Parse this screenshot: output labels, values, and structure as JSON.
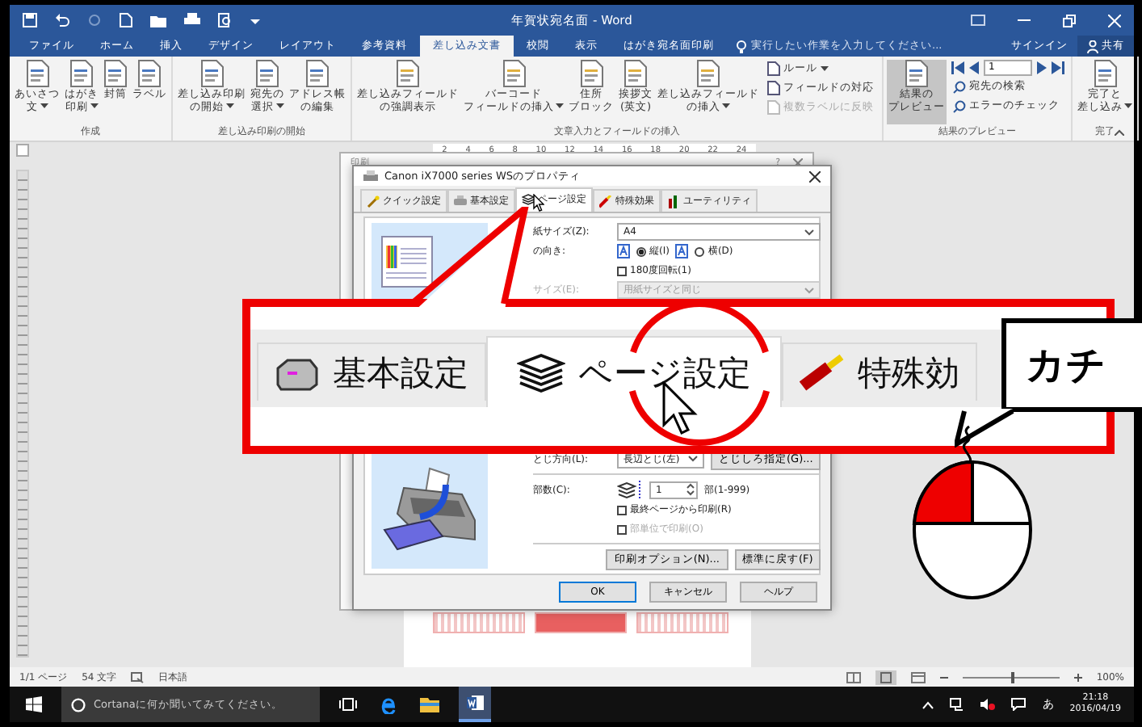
{
  "window": {
    "title": "年賀状宛名面 - Word"
  },
  "ribbon_tabs": [
    {
      "label": "ファイル",
      "selected": false
    },
    {
      "label": "ホーム",
      "selected": false
    },
    {
      "label": "挿入",
      "selected": false
    },
    {
      "label": "デザイン",
      "selected": false
    },
    {
      "label": "レイアウト",
      "selected": false
    },
    {
      "label": "参考資料",
      "selected": false
    },
    {
      "label": "差し込み文書",
      "selected": true
    },
    {
      "label": "校閲",
      "selected": false
    },
    {
      "label": "表示",
      "selected": false
    },
    {
      "label": "はがき宛名面印刷",
      "selected": false
    }
  ],
  "tell_me": {
    "placeholder": "実行したい作業を入力してください..."
  },
  "account": {
    "sign_in": "サインイン",
    "share": "共有"
  },
  "ribbon_groups": [
    {
      "label": "作成",
      "items": [
        {
          "kind": "large",
          "lines": [
            "あいさつ",
            "文"
          ],
          "dropdown": true,
          "selected": false
        },
        {
          "kind": "large",
          "lines": [
            "はがき",
            "印刷"
          ],
          "dropdown": true,
          "selected": false
        },
        {
          "kind": "large",
          "lines": [
            "封筒"
          ],
          "dropdown": false,
          "selected": false
        },
        {
          "kind": "large",
          "lines": [
            "ラベル"
          ],
          "dropdown": false,
          "selected": false
        }
      ]
    },
    {
      "label": "差し込み印刷の開始",
      "items": [
        {
          "kind": "large",
          "lines": [
            "差し込み印刷",
            "の開始"
          ],
          "dropdown": true,
          "selected": false
        },
        {
          "kind": "large",
          "lines": [
            "宛先の",
            "選択"
          ],
          "dropdown": true,
          "selected": false
        },
        {
          "kind": "large",
          "lines": [
            "アドレス帳",
            "の編集"
          ],
          "dropdown": false,
          "selected": false
        }
      ]
    },
    {
      "label": "文章入力とフィールドの挿入",
      "items": [
        {
          "kind": "large",
          "lines": [
            "差し込みフィールド",
            "の強調表示"
          ],
          "dropdown": false,
          "selected": false
        },
        {
          "kind": "large",
          "lines": [
            "バーコード",
            "フィールドの挿入"
          ],
          "dropdown": true,
          "selected": false
        },
        {
          "kind": "large",
          "lines": [
            "住所",
            "ブロック"
          ],
          "dropdown": false,
          "selected": false
        },
        {
          "kind": "large",
          "lines": [
            "挨拶文",
            "(英文)"
          ],
          "dropdown": false,
          "selected": false
        },
        {
          "kind": "large",
          "lines": [
            "差し込みフィールド",
            "の挿入"
          ],
          "dropdown": true,
          "selected": false
        },
        {
          "kind": "small",
          "items": [
            {
              "label": "ルール",
              "dropdown": true,
              "disabled": false
            },
            {
              "label": "フィールドの対応",
              "dropdown": false,
              "disabled": false
            },
            {
              "label": "複数ラベルに反映",
              "dropdown": false,
              "disabled": true
            }
          ]
        }
      ]
    },
    {
      "label": "結果のプレビュー",
      "items": [
        {
          "kind": "large",
          "lines": [
            "結果の",
            "プレビュー"
          ],
          "dropdown": false,
          "selected": true
        },
        {
          "kind": "nav",
          "value": "1",
          "items": [
            {
              "label": "宛先の検索",
              "dropdown": false,
              "disabled": false
            },
            {
              "label": "エラーのチェック",
              "dropdown": false,
              "disabled": false
            }
          ]
        }
      ]
    },
    {
      "label": "完了",
      "items": [
        {
          "kind": "large",
          "lines": [
            "完了と",
            "差し込み"
          ],
          "dropdown": true,
          "selected": false
        }
      ]
    }
  ],
  "ruler_numbers": [
    "2",
    "4",
    "6",
    "8",
    "10",
    "12",
    "14",
    "16",
    "18",
    "20",
    "22",
    "24"
  ],
  "back_dialog": {
    "title": "印刷",
    "help": "?"
  },
  "dialog": {
    "title": "Canon iX7000 series WSのプロパティ",
    "tabs": [
      {
        "label": "クイック設定",
        "selected": false
      },
      {
        "label": "基本設定",
        "selected": false
      },
      {
        "label": "ページ設定",
        "selected": true
      },
      {
        "label": "特殊効果",
        "selected": false
      },
      {
        "label": "ユーティリティ",
        "selected": false
      }
    ],
    "paper_size": {
      "label": "紙サイズ(Z):",
      "value": "A4"
    },
    "orientation": {
      "label": "の向き:",
      "options": [
        {
          "label": "縦(I)",
          "selected": true
        },
        {
          "label": "横(D)",
          "selected": false
        }
      ]
    },
    "rotate": {
      "label": "180度回転(1)",
      "checked": false
    },
    "output_size": {
      "label": "サイズ(E):",
      "value": "用紙サイズと同じ",
      "disabled": true
    },
    "binding": {
      "label": "とじ方向(L):",
      "value": "長辺とじ(左)",
      "button": "とじしろ指定(G)..."
    },
    "copies": {
      "label": "部数(C):",
      "value": "1",
      "unit": "部(1-999)"
    },
    "options": [
      {
        "label": "最終ページから印刷(R)",
        "checked": false,
        "disabled": false
      },
      {
        "label": "部単位で印刷(O)",
        "checked": false,
        "disabled": true
      }
    ],
    "buttons": [
      "印刷オプション(N)...",
      "標準に戻す(F)"
    ],
    "footer_buttons": [
      "OK",
      "キャンセル",
      "ヘルプ"
    ]
  },
  "callout": {
    "tabs": [
      {
        "label": "基本設定",
        "selected": false
      },
      {
        "label": "ページ設定",
        "selected": true
      },
      {
        "label": "特殊効",
        "selected": false
      }
    ],
    "bubble": "カチ"
  },
  "status_bar": {
    "page": "1/1 ページ",
    "words": "54 文字",
    "language": "日本語",
    "zoom": "100%",
    "zoom_level": {
      "level": 0.5
    }
  },
  "taskbar": {
    "search": {
      "placeholder": "Cortanaに何か聞いてみてください。"
    },
    "ime": "あ",
    "time": "21:18",
    "date": "2016/04/19"
  }
}
